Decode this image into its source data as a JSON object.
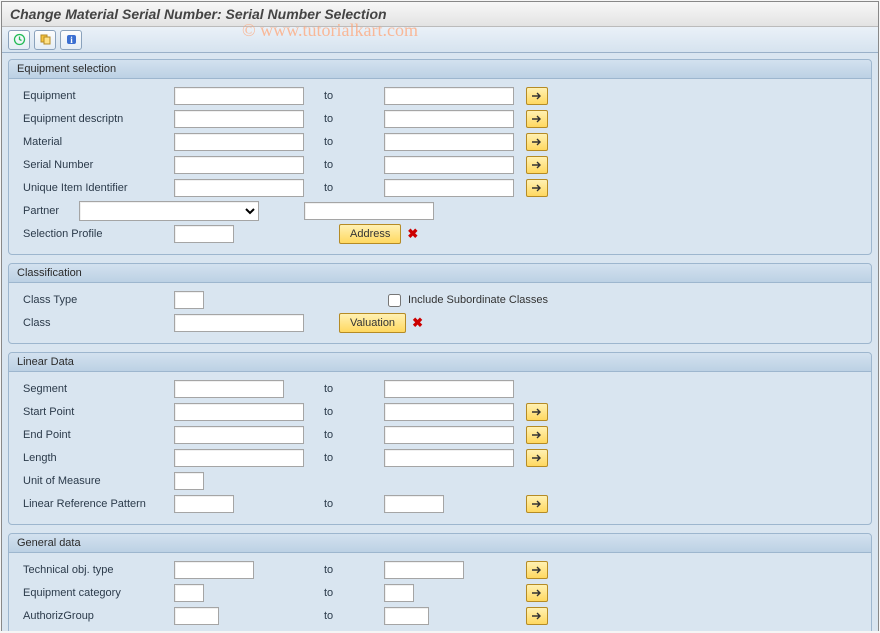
{
  "title": "Change Material Serial Number: Serial Number Selection",
  "watermark": "© www.tutorialkart.com",
  "toolbar": {
    "execute_tip": "Execute",
    "variants_tip": "Get Variant",
    "info_tip": "Information"
  },
  "labels": {
    "to": "to"
  },
  "groups": {
    "equip": {
      "title": "Equipment selection",
      "rows": {
        "equipment": "Equipment",
        "equipment_descriptn": "Equipment descriptn",
        "material": "Material",
        "serial_number": "Serial Number",
        "unique_item_id": "Unique Item Identifier",
        "partner": "Partner",
        "selection_profile": "Selection Profile"
      },
      "address_btn": "Address"
    },
    "classification": {
      "title": "Classification",
      "rows": {
        "class_type": "Class Type",
        "class": "Class"
      },
      "include_sub": "Include Subordinate Classes",
      "valuation_btn": "Valuation"
    },
    "linear": {
      "title": "Linear Data",
      "rows": {
        "segment": "Segment",
        "start_point": "Start Point",
        "end_point": "End Point",
        "length": "Length",
        "uom": "Unit of Measure",
        "lrp": "Linear Reference Pattern"
      }
    },
    "general": {
      "title": "General data",
      "rows": {
        "tech_obj_type": "Technical obj. type",
        "equip_category": "Equipment category",
        "authoriz_group": "AuthorizGroup"
      }
    }
  }
}
